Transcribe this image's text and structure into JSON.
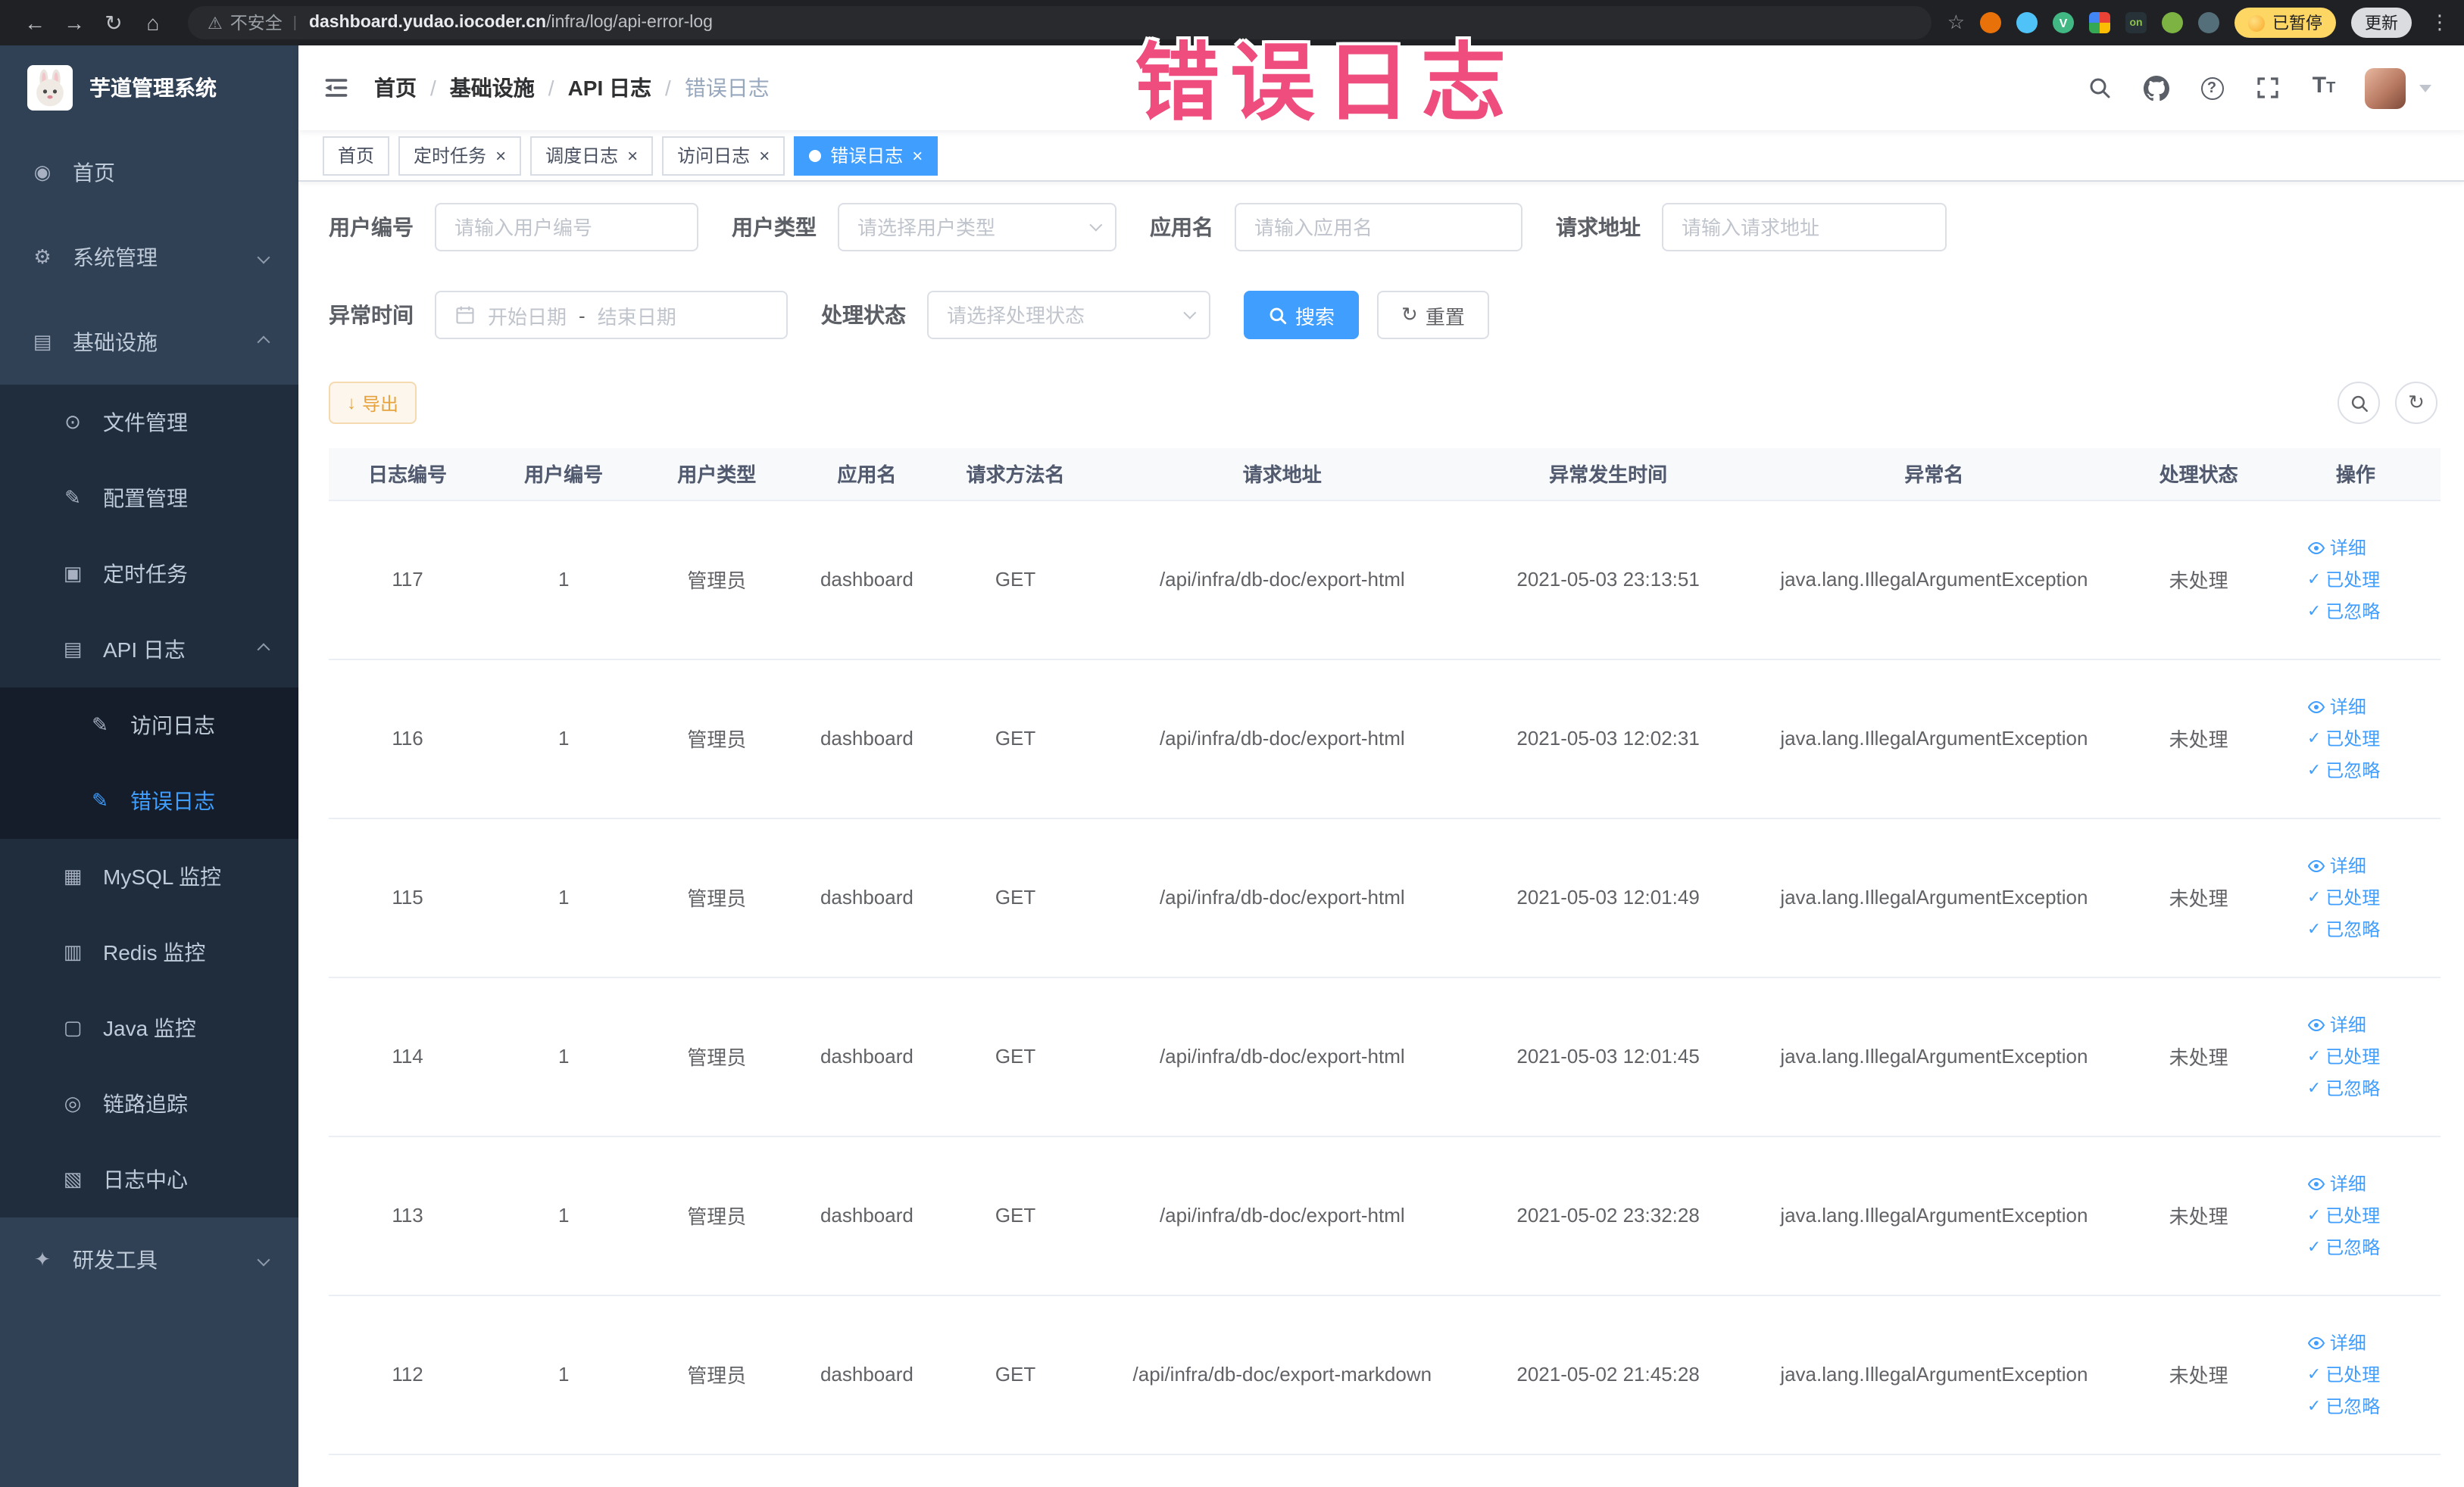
{
  "colors": {
    "accent": "#409eff",
    "sidebar_bg": "#304156",
    "sidebar_sub_bg": "#1f2d3d",
    "annotation_pink": "#ee4d7e",
    "export_warning_text": "#e6a23c",
    "extension_colors": [
      "#e8710a",
      "#4fc3f7",
      "#41b883",
      "#4285f4",
      "#263238",
      "#7cb342",
      "#546e7a"
    ]
  },
  "icons": {
    "back": "←",
    "forward": "→",
    "reload": "↻",
    "home": "⌂",
    "warning": "⚠",
    "star": "☆",
    "menu_dots": "⋮",
    "pipe": "|",
    "dashboard": "◉",
    "gear": "⚙",
    "infra": "▤",
    "file": "⊙",
    "config": "✎",
    "job": "▣",
    "api_log": "▤",
    "access_log": "✎",
    "error_log": "✎",
    "mysql": "▦",
    "redis": "▥",
    "java": "▢",
    "trace": "◎",
    "log_center": "▧",
    "devtools": "✦",
    "question": "?",
    "font_large": "T",
    "font_small": "T",
    "refresh": "↻",
    "download": "↓",
    "check": "✓",
    "close": "×"
  },
  "browser": {
    "security_warning": "不安全",
    "url_domain": "dashboard.yudao.iocoder.cn",
    "url_path": "/infra/log/api-error-log",
    "extensions": {
      "vue_label": "V",
      "proxy_label": "on"
    },
    "paused_badge": "已暂停",
    "update_button": "更新"
  },
  "annotation": {
    "text": "错误日志"
  },
  "sidebar": {
    "logo_title": "芋道管理系统",
    "items": [
      {
        "label": "首页"
      },
      {
        "label": "系统管理"
      },
      {
        "label": "基础设施"
      },
      {
        "label": "文件管理"
      },
      {
        "label": "配置管理"
      },
      {
        "label": "定时任务"
      },
      {
        "label": "API 日志"
      },
      {
        "label": "访问日志"
      },
      {
        "label": "错误日志"
      },
      {
        "label": "MySQL 监控"
      },
      {
        "label": "Redis 监控"
      },
      {
        "label": "Java 监控"
      },
      {
        "label": "链路追踪"
      },
      {
        "label": "日志中心"
      },
      {
        "label": "研发工具"
      }
    ]
  },
  "header": {
    "breadcrumb": [
      "首页",
      "基础设施",
      "API 日志",
      "错误日志"
    ],
    "separator": "/"
  },
  "tabs": [
    {
      "label": "首页"
    },
    {
      "label": "定时任务"
    },
    {
      "label": "调度日志"
    },
    {
      "label": "访问日志"
    },
    {
      "label": "错误日志"
    }
  ],
  "filters": {
    "user_id": {
      "label": "用户编号",
      "placeholder": "请输入用户编号"
    },
    "user_type": {
      "label": "用户类型",
      "placeholder": "请选择用户类型"
    },
    "app_name": {
      "label": "应用名",
      "placeholder": "请输入应用名"
    },
    "request_url": {
      "label": "请求地址",
      "placeholder": "请输入请求地址"
    },
    "exception_time": {
      "label": "异常时间",
      "start_placeholder": "开始日期",
      "separator": "-",
      "end_placeholder": "结束日期"
    },
    "process_status": {
      "label": "处理状态",
      "placeholder": "请选择处理状态"
    },
    "search_button": "搜索",
    "reset_button": "重置"
  },
  "toolbar": {
    "export_button": "导出"
  },
  "table": {
    "columns": [
      "日志编号",
      "用户编号",
      "用户类型",
      "应用名",
      "请求方法名",
      "请求地址",
      "异常发生时间",
      "异常名",
      "处理状态",
      "操作"
    ],
    "actions": [
      "详细",
      "已处理",
      "已忽略"
    ],
    "rows": [
      {
        "id": "117",
        "user_id": "1",
        "user_type": "管理员",
        "app": "dashboard",
        "method": "GET",
        "url": "/api/infra/db-doc/export-html",
        "time": "2021-05-03 23:13:51",
        "exception": "java.lang.IllegalArgumentException",
        "status": "未处理"
      },
      {
        "id": "116",
        "user_id": "1",
        "user_type": "管理员",
        "app": "dashboard",
        "method": "GET",
        "url": "/api/infra/db-doc/export-html",
        "time": "2021-05-03 12:02:31",
        "exception": "java.lang.IllegalArgumentException",
        "status": "未处理"
      },
      {
        "id": "115",
        "user_id": "1",
        "user_type": "管理员",
        "app": "dashboard",
        "method": "GET",
        "url": "/api/infra/db-doc/export-html",
        "time": "2021-05-03 12:01:49",
        "exception": "java.lang.IllegalArgumentException",
        "status": "未处理"
      },
      {
        "id": "114",
        "user_id": "1",
        "user_type": "管理员",
        "app": "dashboard",
        "method": "GET",
        "url": "/api/infra/db-doc/export-html",
        "time": "2021-05-03 12:01:45",
        "exception": "java.lang.IllegalArgumentException",
        "status": "未处理"
      },
      {
        "id": "113",
        "user_id": "1",
        "user_type": "管理员",
        "app": "dashboard",
        "method": "GET",
        "url": "/api/infra/db-doc/export-html",
        "time": "2021-05-02 23:32:28",
        "exception": "java.lang.IllegalArgumentException",
        "status": "未处理"
      },
      {
        "id": "112",
        "user_id": "1",
        "user_type": "管理员",
        "app": "dashboard",
        "method": "GET",
        "url": "/api/infra/db-doc/export-markdown",
        "time": "2021-05-02 21:45:28",
        "exception": "java.lang.IllegalArgumentException",
        "status": "未处理"
      }
    ]
  }
}
